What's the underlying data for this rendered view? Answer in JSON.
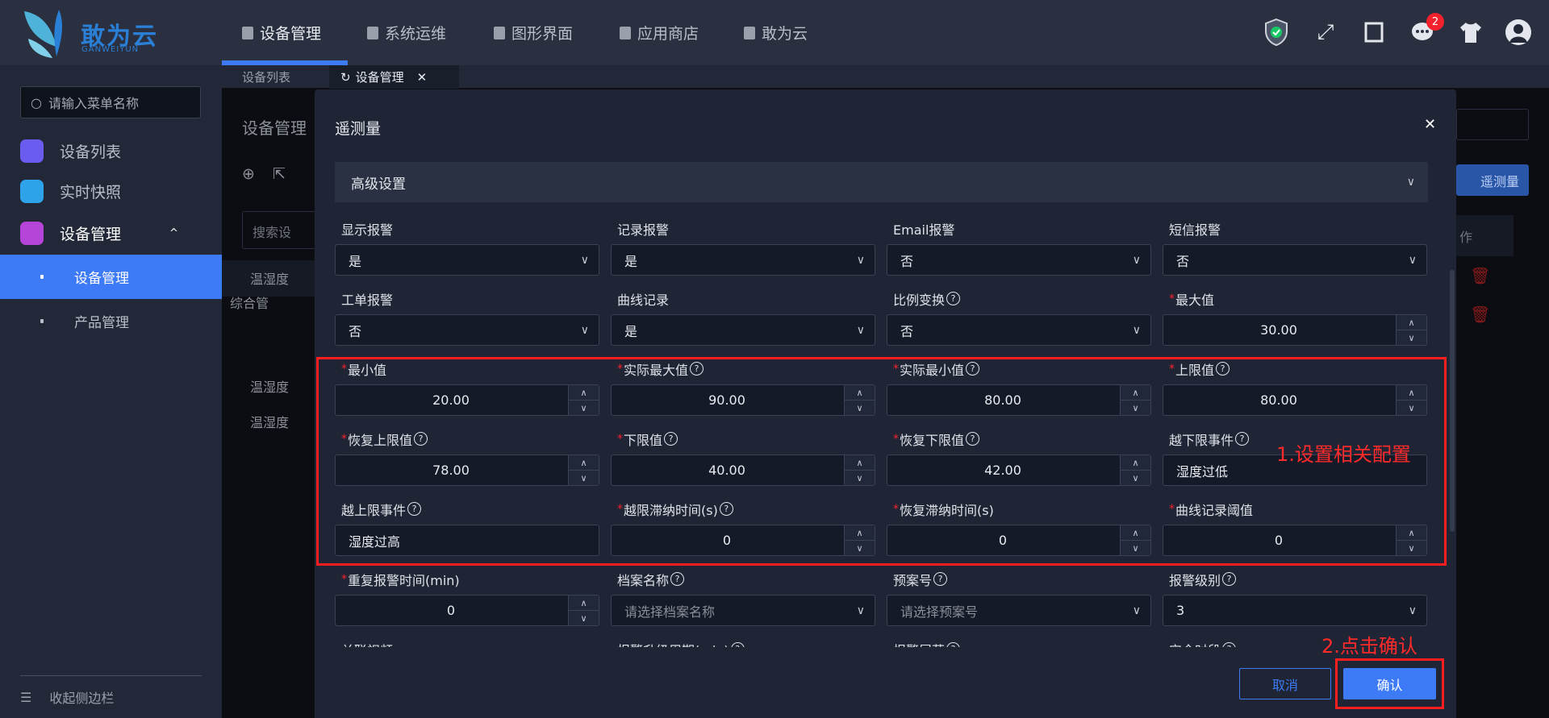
{
  "app": {
    "logo_text": "敢为云",
    "logo_sub": "GANWEIYUN"
  },
  "topnav": {
    "items": [
      {
        "label": "设备管理",
        "icon": "device-icon"
      },
      {
        "label": "系统运维",
        "icon": "wrench-icon"
      },
      {
        "label": "图形界面",
        "icon": "monitor-icon"
      },
      {
        "label": "应用商店",
        "icon": "store-icon"
      },
      {
        "label": "敢为云",
        "icon": "butterfly-icon"
      }
    ],
    "active": 0,
    "notification_count": "2",
    "icons": [
      "shield-icon",
      "expand-icon",
      "fullscreen-icon",
      "chat-icon",
      "shirt-icon",
      "avatar-icon"
    ]
  },
  "tabs": [
    {
      "label": "设备列表"
    },
    {
      "label": "设备管理"
    }
  ],
  "sidebar": {
    "search_placeholder": "请输入菜单名称",
    "items": [
      {
        "label": "设备列表"
      },
      {
        "label": "实时快照"
      },
      {
        "label": "设备管理"
      }
    ],
    "sub_items": [
      {
        "label": "设备管理"
      },
      {
        "label": "产品管理"
      }
    ],
    "collapse": "收起侧边栏"
  },
  "background": {
    "title": "设备管理",
    "search": "搜索设",
    "tree_root": "综合管",
    "rows": [
      "温湿度",
      "温湿度",
      "温湿度"
    ],
    "add_button": "遥测量",
    "col_header": "作"
  },
  "modal": {
    "title": "遥测量",
    "section": "高级设置",
    "cancel": "取消",
    "confirm": "确认",
    "fields": [
      {
        "label": "显示报警",
        "type": "select",
        "value": "是"
      },
      {
        "label": "记录报警",
        "type": "select",
        "value": "是"
      },
      {
        "label": "Email报警",
        "type": "select",
        "value": "否"
      },
      {
        "label": "短信报警",
        "type": "select",
        "value": "否"
      },
      {
        "label": "工单报警",
        "type": "select",
        "value": "否"
      },
      {
        "label": "曲线记录",
        "type": "select",
        "value": "是"
      },
      {
        "label": "比例变换",
        "type": "select",
        "value": "否",
        "help": true
      },
      {
        "label": "最大值",
        "type": "number",
        "value": "30.00",
        "required": true
      },
      {
        "label": "最小值",
        "type": "number",
        "value": "20.00",
        "required": true
      },
      {
        "label": "实际最大值",
        "type": "number",
        "value": "90.00",
        "required": true,
        "help": true
      },
      {
        "label": "实际最小值",
        "type": "number",
        "value": "80.00",
        "required": true,
        "help": true
      },
      {
        "label": "上限值",
        "type": "number",
        "value": "80.00",
        "required": true,
        "help": true
      },
      {
        "label": "恢复上限值",
        "type": "number",
        "value": "78.00",
        "required": true,
        "help": true
      },
      {
        "label": "下限值",
        "type": "number",
        "value": "40.00",
        "required": true,
        "help": true
      },
      {
        "label": "恢复下限值",
        "type": "number",
        "value": "42.00",
        "required": true,
        "help": true
      },
      {
        "label": "越下限事件",
        "type": "text",
        "value": "湿度过低",
        "help": true
      },
      {
        "label": "越上限事件",
        "type": "text",
        "value": "湿度过高",
        "help": true
      },
      {
        "label": "越限滞纳时间(s)",
        "type": "number",
        "value": "0",
        "required": true,
        "help": true
      },
      {
        "label": "恢复滞纳时间(s)",
        "type": "number",
        "value": "0",
        "required": true
      },
      {
        "label": "曲线记录阈值",
        "type": "number",
        "value": "0",
        "required": true
      },
      {
        "label": "重复报警时间(min)",
        "type": "number",
        "value": "0",
        "required": true
      },
      {
        "label": "档案名称",
        "type": "select",
        "placeholder": "请选择档案名称",
        "help": true
      },
      {
        "label": "预案号",
        "type": "select",
        "placeholder": "请选择预案号",
        "help": true
      },
      {
        "label": "报警级别",
        "type": "select",
        "value": "3",
        "help": true
      },
      {
        "label": "关联视频",
        "type": "select"
      },
      {
        "label": "报警升级周期(min)",
        "type": "number",
        "help": true
      },
      {
        "label": "报警屏蔽",
        "type": "select",
        "help": true
      },
      {
        "label": "安全时段",
        "type": "select",
        "help": true
      }
    ]
  },
  "annotations": {
    "step1": "1.设置相关配置",
    "step2": "2.点击确认"
  },
  "colors": {
    "accent": "#3d7af5",
    "annotation": "#ff1f1f",
    "badge": "#f5222d"
  }
}
